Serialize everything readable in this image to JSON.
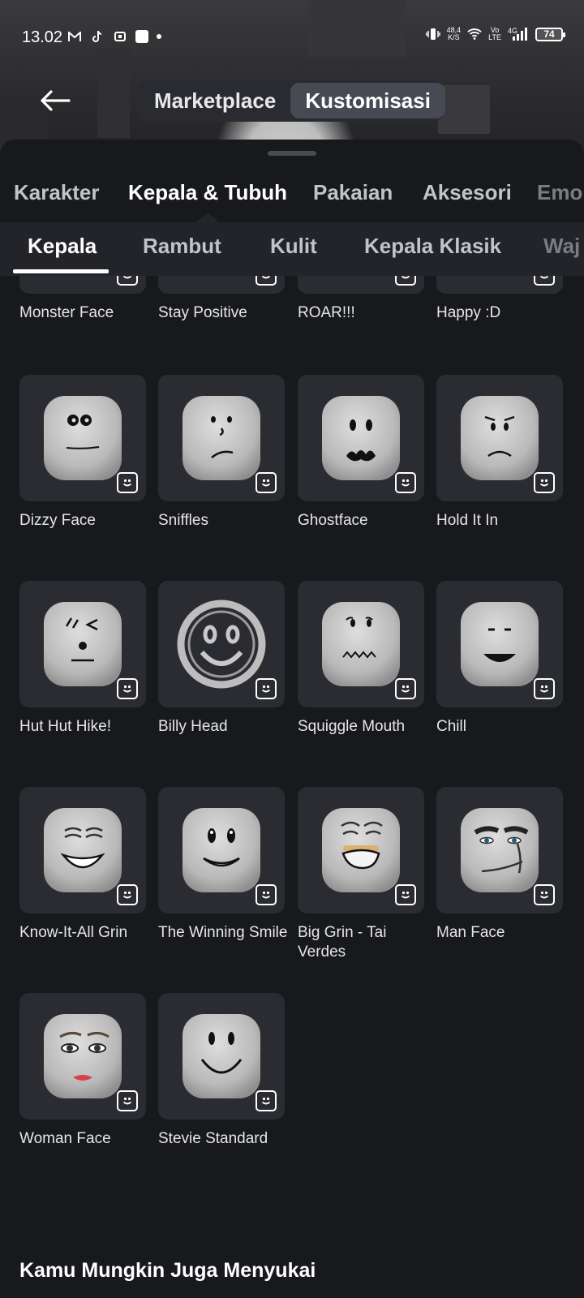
{
  "status_bar": {
    "time": "13.02",
    "net_speed_value": "48,4",
    "net_speed_unit": "K/S",
    "volte_top": "Vo",
    "volte_bottom": "LTE",
    "network": "4G",
    "battery": "74"
  },
  "header": {
    "back_icon": "arrow-left-icon",
    "tabs": [
      {
        "label": "Marketplace",
        "active": false
      },
      {
        "label": "Kustomisasi",
        "active": true
      }
    ]
  },
  "category_tabs": [
    {
      "label": "Karakter",
      "active": false
    },
    {
      "label": "Kepala & Tubuh",
      "active": true
    },
    {
      "label": "Pakaian",
      "active": false
    },
    {
      "label": "Aksesori",
      "active": false
    },
    {
      "label": "Emo",
      "active": false
    }
  ],
  "sub_tabs": [
    {
      "label": "Kepala",
      "active": true
    },
    {
      "label": "Rambut",
      "active": false
    },
    {
      "label": "Kulit",
      "active": false
    },
    {
      "label": "Kepala Klasik",
      "active": false
    },
    {
      "label": "Waj",
      "active": false
    }
  ],
  "items": [
    {
      "name": "Monster Face",
      "face": "monster"
    },
    {
      "name": "Stay Positive",
      "face": "stay-positive"
    },
    {
      "name": "ROAR!!!",
      "face": "roar"
    },
    {
      "name": "Happy :D",
      "face": "happy"
    },
    {
      "name": "Dizzy Face",
      "face": "dizzy"
    },
    {
      "name": "Sniffles",
      "face": "sniffles"
    },
    {
      "name": "Ghostface",
      "face": "ghost"
    },
    {
      "name": "Hold It In",
      "face": "hold-it-in"
    },
    {
      "name": "Hut Hut Hike!",
      "face": "hut-hut"
    },
    {
      "name": "Billy Head",
      "face": "billy"
    },
    {
      "name": "Squiggle Mouth",
      "face": "squiggle"
    },
    {
      "name": "Chill",
      "face": "chill"
    },
    {
      "name": "Know-It-All Grin",
      "face": "know-it-all"
    },
    {
      "name": "The Winning Smile",
      "face": "winning-smile"
    },
    {
      "name": "Big Grin - Tai Verdes",
      "face": "big-grin"
    },
    {
      "name": "Man Face",
      "face": "man-face"
    },
    {
      "name": "Woman Face",
      "face": "woman-face"
    },
    {
      "name": "Stevie Standard",
      "face": "stevie"
    }
  ],
  "item_badge_icon": "face-badge-icon",
  "section_title": "Kamu Mungkin Juga Menyukai"
}
